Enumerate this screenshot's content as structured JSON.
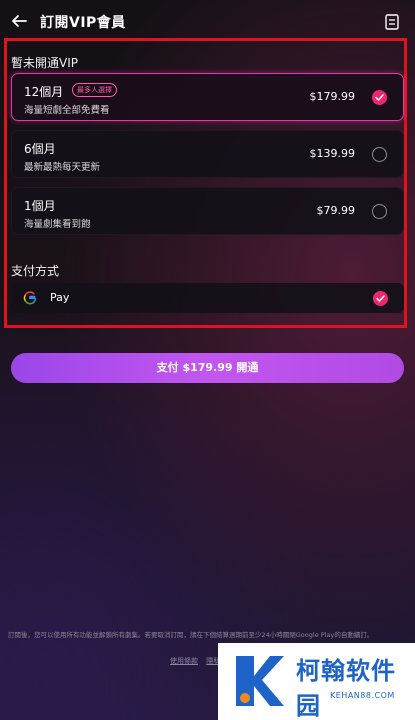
{
  "header": {
    "title": "訂閱VIP會員"
  },
  "section_status": "暫未開通VIP",
  "plans": [
    {
      "name": "12個月",
      "badge": "最多人選擇",
      "desc": "海量短劇全部免費看",
      "price": "$179.99",
      "selected": true
    },
    {
      "name": "6個月",
      "desc": "最新最熱每天更新",
      "price": "$139.99",
      "selected": false
    },
    {
      "name": "1個月",
      "desc": "海量劇集看到飽",
      "price": "$79.99",
      "selected": false
    }
  ],
  "payment": {
    "section_title": "支付方式",
    "method_label": "Pay",
    "selected": true
  },
  "pay_button": {
    "label": "支付 $179.99 開通"
  },
  "footer": {
    "disclaimer": "訂閱後，您可以使用所有功能並解鎖所有劇集。若要取消訂閱，請在下個結算週期前至少24小時關閉Google Play的自動續訂。",
    "terms_link": "使用條款",
    "privacy_link": "隱私政策"
  },
  "watermark": {
    "text": "柯翰软件园",
    "sub": "KEHAN88.COM"
  },
  "colors": {
    "accent": "#f0276e",
    "selected_border": "#e23aa6",
    "button": "#b14ae4",
    "highlight_frame": "#e2111a"
  }
}
